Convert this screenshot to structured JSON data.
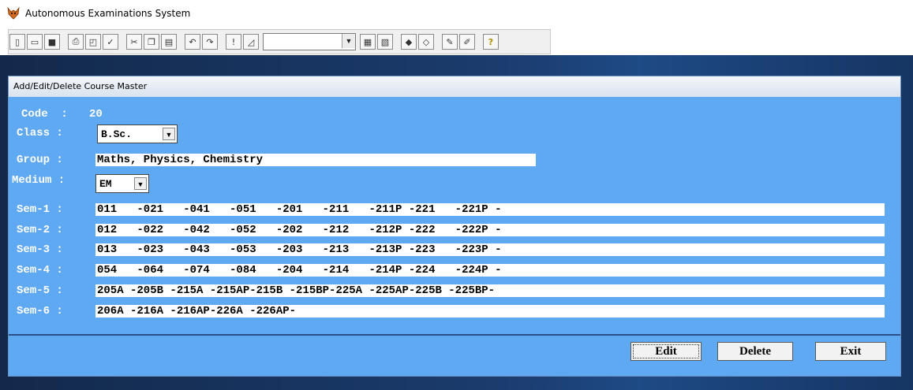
{
  "app": {
    "title": "Autonomous Examinations System"
  },
  "toolbar": {
    "buttons": [
      "new-icon",
      "open-icon",
      "save-icon",
      "print-icon",
      "print-preview-icon",
      "spellcheck-icon",
      "cut-icon",
      "copy-icon",
      "paste-icon",
      "undo-icon",
      "redo-icon",
      "exclamation-icon",
      "chart-icon",
      "report-icon",
      "form-icon",
      "select-a-icon",
      "select-b-icon",
      "edit-a-icon",
      "edit-b-icon",
      "help-icon"
    ],
    "combo_value": ""
  },
  "window": {
    "title": "Add/Edit/Delete Course Master"
  },
  "form": {
    "code_label": "Code  :",
    "code_value": "20",
    "class_label": "Class :",
    "class_value": "B.Sc.",
    "group_label": "Group :",
    "group_value": "Maths, Physics, Chemistry",
    "medium_label": "Medium :",
    "medium_value": "EM",
    "semesters": [
      {
        "label": "Sem-1 :",
        "value": "011   -021   -041   -051   -201   -211   -211P -221   -221P -"
      },
      {
        "label": "Sem-2 :",
        "value": "012   -022   -042   -052   -202   -212   -212P -222   -222P -"
      },
      {
        "label": "Sem-3 :",
        "value": "013   -023   -043   -053   -203   -213   -213P -223   -223P -"
      },
      {
        "label": "Sem-4 :",
        "value": "054   -064   -074   -084   -204   -214   -214P -224   -224P -"
      },
      {
        "label": "Sem-5 :",
        "value": "205A -205B -215A -215AP-215B -215BP-225A -225AP-225B -225BP-"
      },
      {
        "label": "Sem-6 :",
        "value": "206A -216A -216AP-226A -226AP-"
      }
    ]
  },
  "actions": {
    "edit_label": "Edit",
    "delete_label": "Delete",
    "exit_label": "Exit"
  }
}
